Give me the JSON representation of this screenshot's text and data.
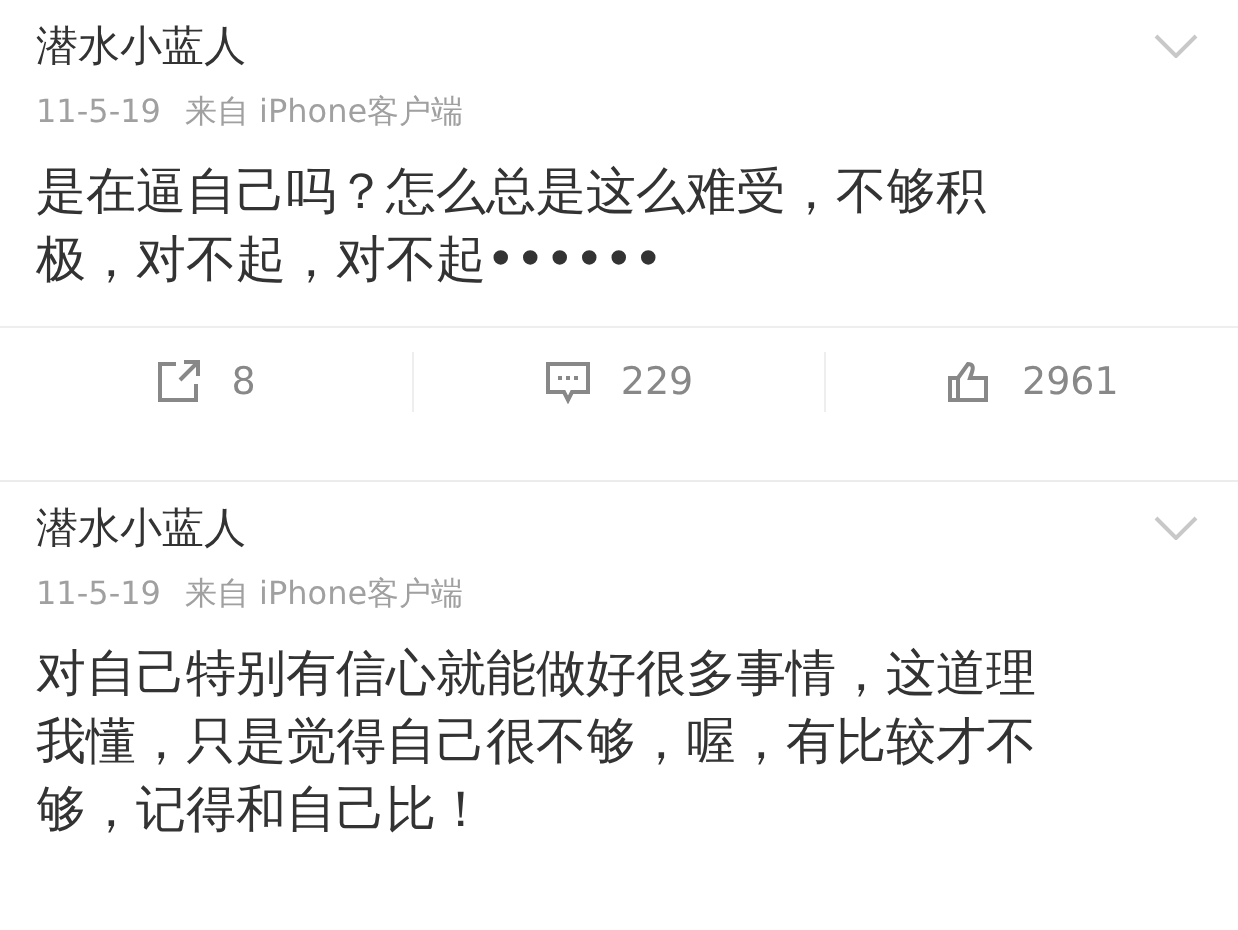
{
  "posts": [
    {
      "author": "潜水小蓝人",
      "date": "11-5-19",
      "source": "来自 iPhone客户端",
      "body_lines": [
        "是在逼自己吗？怎么总是这么难受，不够积",
        "极，对不起，对不起••••••"
      ],
      "actions": [
        {
          "kind": "repost",
          "count": "8"
        },
        {
          "kind": "comment",
          "count": "229"
        },
        {
          "kind": "like",
          "count": "2961"
        }
      ]
    },
    {
      "author": "潜水小蓝人",
      "date": "11-5-19",
      "source": "来自 iPhone客户端",
      "body_lines": [
        "对自己特别有信心就能做好很多事情，这道理",
        "我懂，只是觉得自己很不够，喔，有比较才不",
        "够，记得和自己比！"
      ]
    }
  ]
}
